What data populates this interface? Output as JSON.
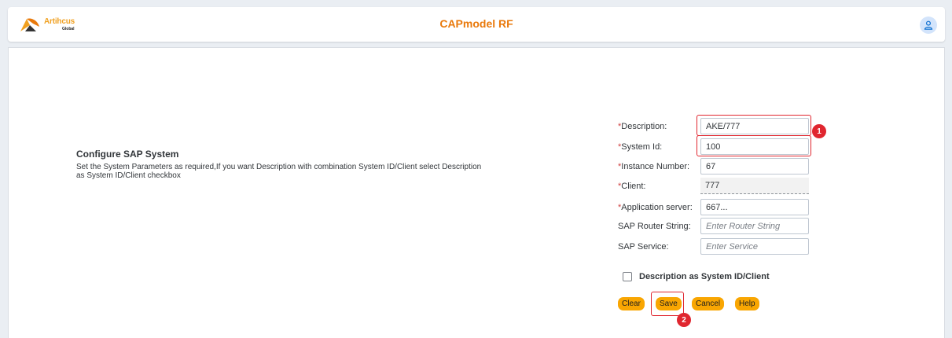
{
  "header": {
    "brand_name": "Artihcus",
    "brand_sub": "Global",
    "app_title": "CAPmodel RF",
    "icons": {
      "logo": "artihcus-logo",
      "user": "user-icon"
    }
  },
  "intro": {
    "title": "Configure SAP System",
    "description": "Set the System Parameters as required,If you want Description with combination System ID/Client select Description as System ID/Client checkbox"
  },
  "form": {
    "required_marker": "*",
    "description": {
      "label": "Description:",
      "value": "AKE/777"
    },
    "system_id": {
      "label": "System Id:",
      "value": "100"
    },
    "instance_number": {
      "label": "Instance Number:",
      "value": "67"
    },
    "client": {
      "label": "Client:",
      "value": "777"
    },
    "application_server": {
      "label": "Application server:",
      "value": "667..."
    },
    "sap_router_string": {
      "label": "SAP Router String:",
      "value": "",
      "placeholder": "Enter Router String"
    },
    "sap_service": {
      "label": "SAP Service:",
      "value": "",
      "placeholder": "Enter Service"
    },
    "checkbox": {
      "label": "Description as System ID/Client",
      "checked": false
    }
  },
  "buttons": {
    "clear": "Clear",
    "save": "Save",
    "cancel": "Cancel",
    "help": "Help"
  },
  "annotations": {
    "step1": "1",
    "step2": "2",
    "color": "#e0262f"
  },
  "colors": {
    "accent": "#e9790b",
    "button": "#f9a602",
    "required": "#d04343"
  }
}
